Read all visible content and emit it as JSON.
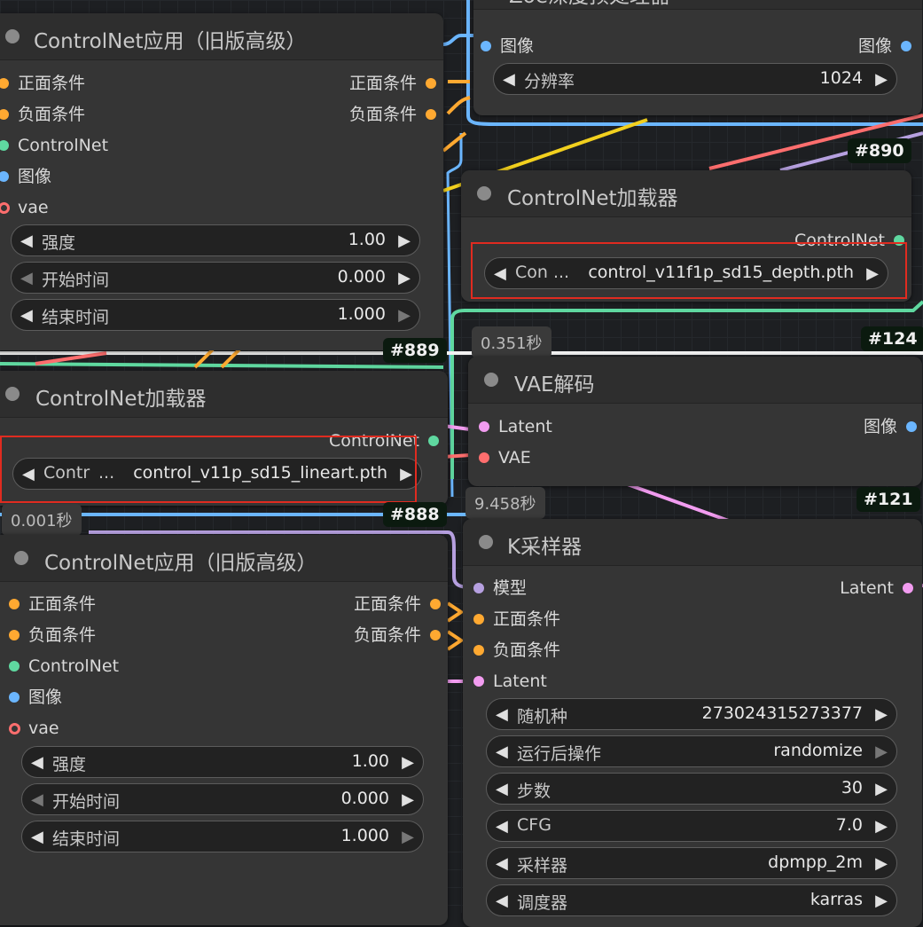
{
  "nodes": {
    "top_apply": {
      "title": "ControlNet应用（旧版高级）",
      "inputs": [
        "正面条件",
        "负面条件",
        "ControlNet",
        "图像",
        "vae"
      ],
      "outputs": [
        "正面条件",
        "负面条件"
      ],
      "widgets": [
        {
          "label": "强度",
          "value": "1.00"
        },
        {
          "label": "开始时间",
          "value": "0.000"
        },
        {
          "label": "结束时间",
          "value": "1.000"
        }
      ]
    },
    "zoe": {
      "title": "Zoe深度预处理器",
      "input": "图像",
      "output": "图像",
      "widget": {
        "label": "分辨率",
        "value": "1024"
      }
    },
    "loader_right": {
      "badge": "#890",
      "title": "ControlNet加载器",
      "output": "ControlNet",
      "widget": {
        "label": "Con ...",
        "value": "control_v11f1p_sd15_depth.pth"
      }
    },
    "loader_left": {
      "badge": "#889",
      "title": "ControlNet加载器",
      "output": "ControlNet",
      "widget": {
        "label": "Contr",
        "ellipsis": "...",
        "value": "control_v11p_sd15_lineart.pth"
      }
    },
    "vae_decode": {
      "badge": "#124",
      "timing": "0.351秒",
      "title": "VAE解码",
      "inputs": [
        "Latent",
        "VAE"
      ],
      "output": "图像"
    },
    "bottom_apply": {
      "badge": "#888",
      "timing": "0.001秒",
      "title": "ControlNet应用（旧版高级）",
      "inputs": [
        "正面条件",
        "负面条件",
        "ControlNet",
        "图像",
        "vae"
      ],
      "outputs": [
        "正面条件",
        "负面条件"
      ],
      "widgets": [
        {
          "label": "强度",
          "value": "1.00"
        },
        {
          "label": "开始时间",
          "value": "0.000"
        },
        {
          "label": "结束时间",
          "value": "1.000"
        }
      ]
    },
    "ksampler": {
      "badge": "#121",
      "timing": "9.458秒",
      "title": "K采样器",
      "inputs": [
        "模型",
        "正面条件",
        "负面条件",
        "Latent"
      ],
      "output": "Latent",
      "widgets": [
        {
          "label": "随机种",
          "value": "273024315273377"
        },
        {
          "label": "运行后操作",
          "value": "randomize"
        },
        {
          "label": "步数",
          "value": "30"
        },
        {
          "label": "CFG",
          "value": "7.0"
        },
        {
          "label": "采样器",
          "value": "dpmpp_2m"
        },
        {
          "label": "调度器",
          "value": "karras"
        }
      ]
    }
  },
  "icons": {
    "arrow_left": "◀",
    "arrow_right": "▶"
  },
  "colors": {
    "conditioning": "#ffa931",
    "controlnet": "#5fd8a0",
    "image": "#6bb6ff",
    "vae": "#ff6e6e",
    "latent": "#f29cf0",
    "model": "#b6a0e0",
    "highlight_box": "#e02b20"
  }
}
